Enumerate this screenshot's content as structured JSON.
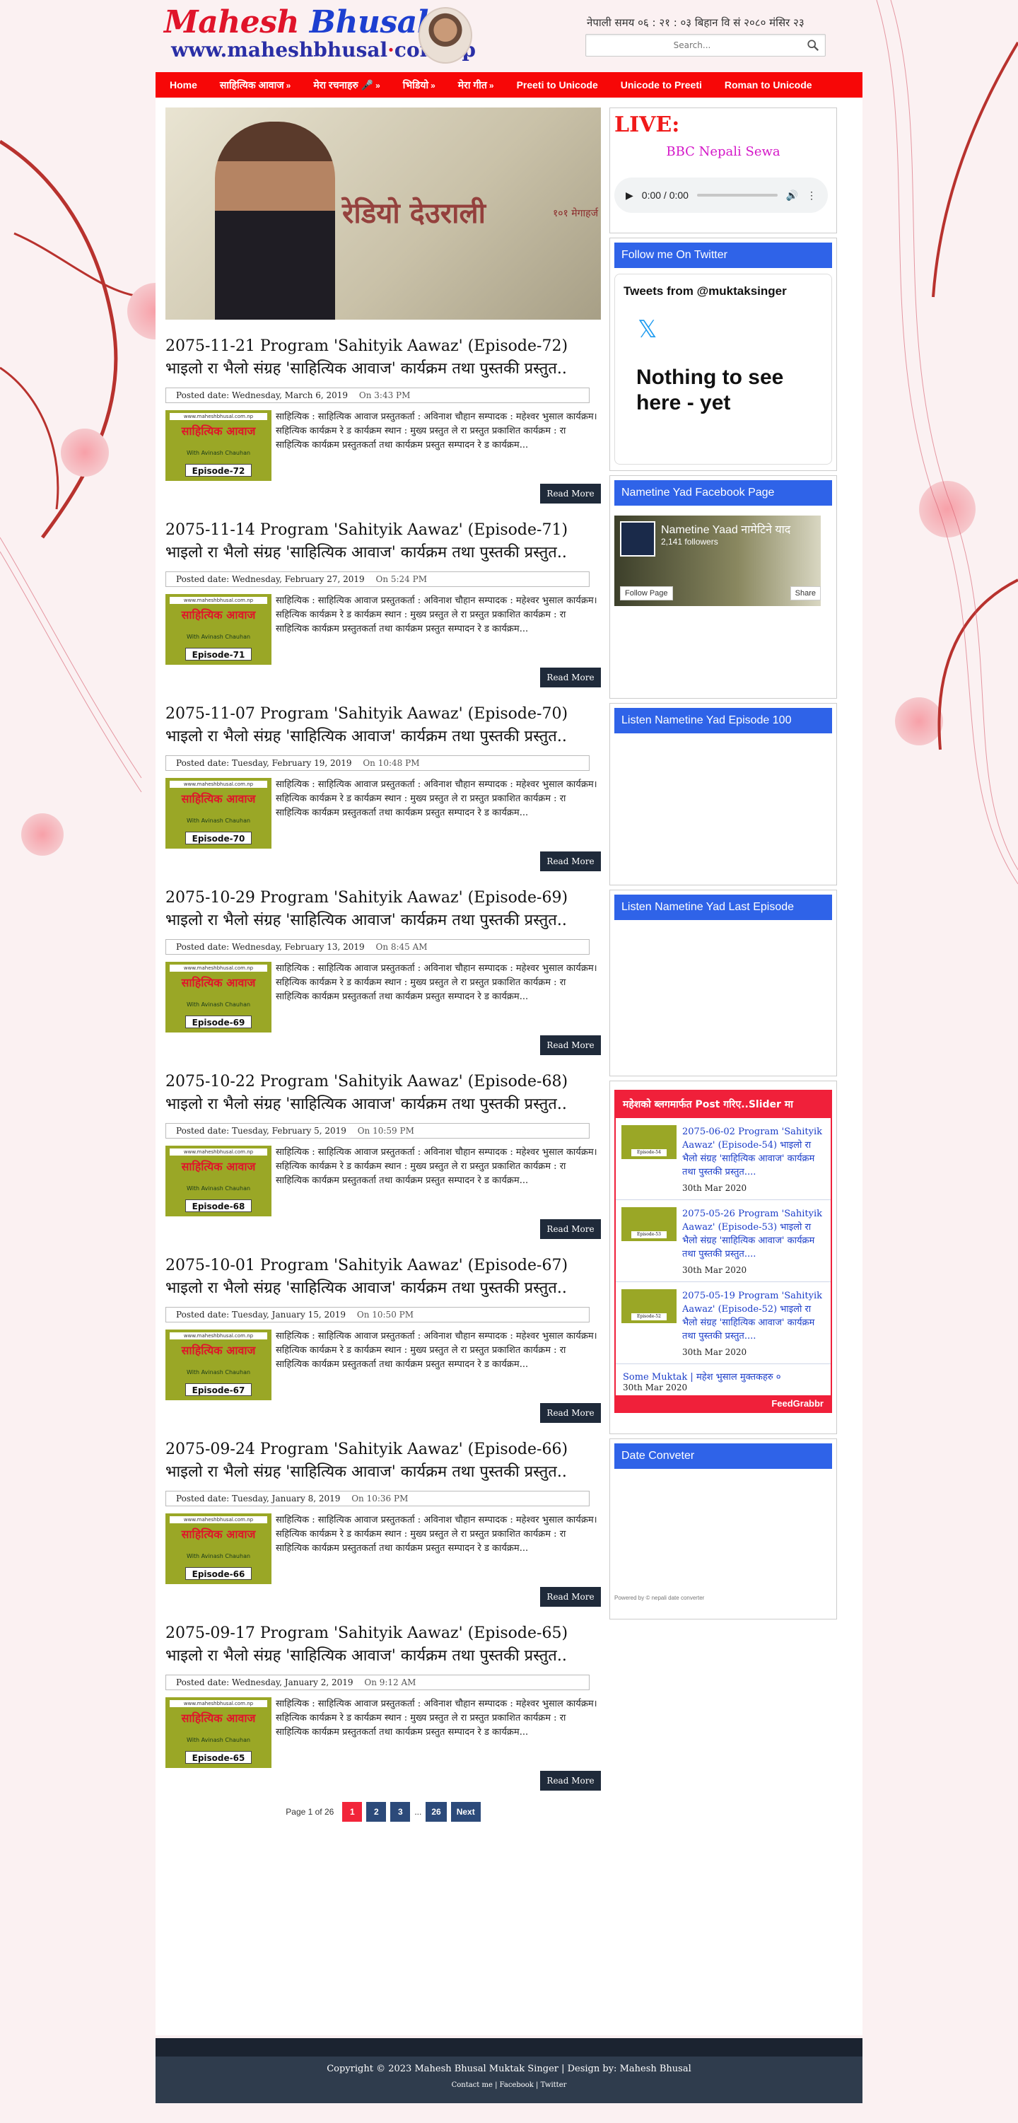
{
  "header": {
    "logo_first": "Mahesh",
    "logo_last": "Bhusal",
    "logo_url_parts": [
      "www.maheshbhusal",
      "com",
      "np"
    ],
    "datetime": "नेपाली समय ०६ : २१ : ०३ बिहान   वि सं २०८० मंसिर २३",
    "search_placeholder": "Search..."
  },
  "nav": {
    "items": [
      {
        "label": "Home",
        "arrow": ""
      },
      {
        "label": "साहित्यिक आवाज",
        "arrow": "»"
      },
      {
        "label": "मेरा रचनाहरु 🎤",
        "arrow": "»"
      },
      {
        "label": "भिडियो",
        "arrow": "»"
      },
      {
        "label": "मेरा गीत",
        "arrow": "»"
      },
      {
        "label": "Preeti to Unicode",
        "arrow": ""
      },
      {
        "label": "Unicode to Preeti",
        "arrow": ""
      },
      {
        "label": "Roman to Unicode",
        "arrow": ""
      }
    ]
  },
  "featured": {
    "radio_text": "रेडियो देउराली",
    "radio_sub": "१०१ मेगाहर्ज"
  },
  "thumb_common": {
    "site": "www.maheshbhusal.com.np",
    "title": "साहित्यिक आवाज",
    "with": "With Avinash Chauhan"
  },
  "posts": [
    {
      "title": "2075-11-21 Program 'Sahityik Aawaz' (Episode-72) भाइलो रा भैलो संग्रह 'साहित्यिक आवाज' कार्यक्रम तथा पुस्तकी प्रस्तुत..",
      "date": "Wednesday, March 6, 2019",
      "time": "On 3:43 PM",
      "episode": "Episode-72",
      "excerpt": "साहित्यिक : साहित्यिक आवाज  प्रस्तुतकर्ता : अविनाश चौहान  सम्पादक : महेश्वर भुसाल कार्यक्रम। सहित्यिक कार्यक्रम रे ड कार्यक्रम  स्थान : मुख्य प्रस्तुत ले रा प्रस्तुत  प्रकाशित कार्यक्रम : रा साहित्यिक कार्यक्रम प्रस्तुतकर्ता तथा कार्यक्रम प्रस्तुत सम्पादन रे ड कार्यक्रम...",
      "read_more": "Read More"
    },
    {
      "title": "2075-11-14 Program 'Sahityik Aawaz' (Episode-71) भाइलो रा भैलो संग्रह 'साहित्यिक आवाज' कार्यक्रम तथा पुस्तकी प्रस्तुत..",
      "date": "Wednesday, February 27, 2019",
      "time": "On 5:24 PM",
      "episode": "Episode-71",
      "excerpt": "साहित्यिक : साहित्यिक आवाज  प्रस्तुतकर्ता : अविनाश चौहान  सम्पादक : महेश्वर भुसाल कार्यक्रम। सहित्यिक कार्यक्रम रे ड कार्यक्रम  स्थान : मुख्य प्रस्तुत ले रा प्रस्तुत  प्रकाशित कार्यक्रम : रा साहित्यिक कार्यक्रम प्रस्तुतकर्ता तथा कार्यक्रम प्रस्तुत सम्पादन रे ड कार्यक्रम...",
      "read_more": "Read More"
    },
    {
      "title": "2075-11-07 Program 'Sahityik Aawaz' (Episode-70) भाइलो रा भैलो संग्रह 'साहित्यिक आवाज' कार्यक्रम तथा पुस्तकी प्रस्तुत..",
      "date": "Tuesday, February 19, 2019",
      "time": "On 10:48 PM",
      "episode": "Episode-70",
      "excerpt": "साहित्यिक : साहित्यिक आवाज  प्रस्तुतकर्ता : अविनाश चौहान  सम्पादक : महेश्वर भुसाल कार्यक्रम। सहित्यिक कार्यक्रम रे ड कार्यक्रम  स्थान : मुख्य प्रस्तुत ले रा प्रस्तुत  प्रकाशित कार्यक्रम : रा साहित्यिक कार्यक्रम प्रस्तुतकर्ता तथा कार्यक्रम प्रस्तुत सम्पादन रे ड कार्यक्रम...",
      "read_more": "Read More"
    },
    {
      "title": "2075-10-29 Program 'Sahityik Aawaz' (Episode-69) भाइलो रा भैलो संग्रह 'साहित्यिक आवाज' कार्यक्रम तथा पुस्तकी प्रस्तुत..",
      "date": "Wednesday, February 13, 2019",
      "time": "On 8:45 AM",
      "episode": "Episode-69",
      "excerpt": "साहित्यिक : साहित्यिक आवाज  प्रस्तुतकर्ता : अविनाश चौहान  सम्पादक : महेश्वर भुसाल कार्यक्रम। सहित्यिक कार्यक्रम रे ड कार्यक्रम  स्थान : मुख्य प्रस्तुत ले रा प्रस्तुत  प्रकाशित कार्यक्रम : रा साहित्यिक कार्यक्रम प्रस्तुतकर्ता तथा कार्यक्रम प्रस्तुत सम्पादन रे ड कार्यक्रम...",
      "read_more": "Read More"
    },
    {
      "title": "2075-10-22 Program 'Sahityik Aawaz' (Episode-68) भाइलो रा भैलो संग्रह 'साहित्यिक आवाज' कार्यक्रम तथा पुस्तकी प्रस्तुत..",
      "date": "Tuesday, February 5, 2019",
      "time": "On 10:59 PM",
      "episode": "Episode-68",
      "excerpt": "साहित्यिक : साहित्यिक आवाज  प्रस्तुतकर्ता : अविनाश चौहान  सम्पादक : महेश्वर भुसाल कार्यक्रम। सहित्यिक कार्यक्रम रे ड कार्यक्रम  स्थान : मुख्य प्रस्तुत ले रा प्रस्तुत  प्रकाशित कार्यक्रम : रा साहित्यिक कार्यक्रम प्रस्तुतकर्ता तथा कार्यक्रम प्रस्तुत सम्पादन रे ड कार्यक्रम...",
      "read_more": "Read More"
    },
    {
      "title": "2075-10-01 Program 'Sahityik Aawaz' (Episode-67) भाइलो रा भैलो संग्रह 'साहित्यिक आवाज' कार्यक्रम तथा पुस्तकी प्रस्तुत..",
      "date": "Tuesday, January 15, 2019",
      "time": "On 10:50 PM",
      "episode": "Episode-67",
      "excerpt": "साहित्यिक : साहित्यिक आवाज  प्रस्तुतकर्ता : अविनाश चौहान  सम्पादक : महेश्वर भुसाल कार्यक्रम। सहित्यिक कार्यक्रम रे ड कार्यक्रम  स्थान : मुख्य प्रस्तुत ले रा प्रस्तुत  प्रकाशित कार्यक्रम : रा साहित्यिक कार्यक्रम प्रस्तुतकर्ता तथा कार्यक्रम प्रस्तुत सम्पादन रे ड कार्यक्रम...",
      "read_more": "Read More"
    },
    {
      "title": "2075-09-24 Program 'Sahityik Aawaz' (Episode-66) भाइलो रा भैलो संग्रह 'साहित्यिक आवाज' कार्यक्रम तथा पुस्तकी प्रस्तुत..",
      "date": "Tuesday, January 8, 2019",
      "time": "On 10:36 PM",
      "episode": "Episode-66",
      "excerpt": "साहित्यिक : साहित्यिक आवाज  प्रस्तुतकर्ता : अविनाश चौहान  सम्पादक : महेश्वर भुसाल कार्यक्रम। सहित्यिक कार्यक्रम रे ड कार्यक्रम  स्थान : मुख्य प्रस्तुत ले रा प्रस्तुत  प्रकाशित कार्यक्रम : रा साहित्यिक कार्यक्रम प्रस्तुतकर्ता तथा कार्यक्रम प्रस्तुत सम्पादन रे ड कार्यक्रम...",
      "read_more": "Read More"
    },
    {
      "title": "2075-09-17 Program 'Sahityik Aawaz' (Episode-65) भाइलो रा भैलो संग्रह 'साहित्यिक आवाज' कार्यक्रम तथा पुस्तकी प्रस्तुत..",
      "date": "Wednesday, January 2, 2019",
      "time": "On 9:12 AM",
      "episode": "Episode-65",
      "excerpt": "साहित्यिक : साहित्यिक आवाज  प्रस्तुतकर्ता : अविनाश चौहान  सम्पादक : महेश्वर भुसाल कार्यक्रम। सहित्यिक कार्यक्रम रे ड कार्यक्रम  स्थान : मुख्य प्रस्तुत ले रा प्रस्तुत  प्रकाशित कार्यक्रम : रा साहित्यिक कार्यक्रम प्रस्तुतकर्ता तथा कार्यक्रम प्रस्तुत सम्पादन रे ड कार्यक्रम...",
      "read_more": "Read More"
    }
  ],
  "posted_label": "Posted date:",
  "pagination": {
    "label": "Page 1 of 26",
    "pages": [
      "1",
      "2",
      "3"
    ],
    "dots": "...",
    "last": "26",
    "next": "Next"
  },
  "sidebar": {
    "live_title": "LIVE:",
    "bbc": "BBC Nepali Sewa",
    "audio_time": "0:00 / 0:00",
    "twitter_title": "Follow me On Twitter",
    "tweets_from": "Tweets from @muktaksinger",
    "nothing": "Nothing to see here - yet",
    "fb_title": "Nametine Yad Facebook Page",
    "fb_name": "Nametine Yaad नामेटिने याद",
    "fb_likes": "2,141 followers",
    "fb_follow": "Follow Page",
    "fb_share": "Share",
    "ep100_title": "Listen Nametine Yad Episode 100",
    "last_title": "Listen Nametine Yad Last Episode",
    "feed_title": "महेशको ब्लगमार्फत Post गरिए..Slider मा",
    "feed_items": [
      {
        "text": "2075-06-02 Program 'Sahityik Aawaz' (Episode-54) भाइलो रा भैलो संग्रह 'साहित्यिक आवाज' कार्यक्रम तथा पुस्तकी प्रस्तुत....",
        "date": "30th Mar 2020",
        "ep": "Episode-54"
      },
      {
        "text": "2075-05-26 Program 'Sahityik Aawaz' (Episode-53) भाइलो रा भैलो संग्रह 'साहित्यिक आवाज' कार्यक्रम तथा पुस्तकी प्रस्तुत....",
        "date": "30th Mar 2020",
        "ep": "Episode-53"
      },
      {
        "text": "2075-05-19 Program 'Sahityik Aawaz' (Episode-52) भाइलो रा भैलो संग्रह 'साहित्यिक आवाज' कार्यक्रम तथा पुस्तकी प्रस्तुत....",
        "date": "30th Mar 2020",
        "ep": "Episode-52"
      }
    ],
    "feed_more": "Some Muktak | महेश भुसाल मुक्तकहरु ०",
    "feed_more_date": "30th Mar 2020",
    "feed_foot": "FeedGrabbr",
    "date_conv_title": "Date Conveter",
    "powered": "Powered by © nepali date converter"
  },
  "footer": {
    "copy": "Copyright © 2023 Mahesh Bhusal Muktak Singer | Design by: Mahesh Bhusal",
    "links": "Contact me | Facebook | Twitter"
  },
  "colors": {
    "nav": "#f70707",
    "accent_blue": "#2f63e8",
    "feed_red": "#f0203a"
  }
}
